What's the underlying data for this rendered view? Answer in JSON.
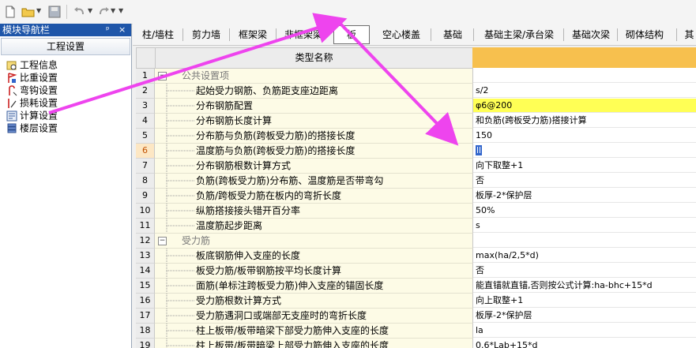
{
  "toolbar": {
    "buttons": [
      "new-file-icon",
      "open-folder-icon",
      "save-icon",
      "undo-icon",
      "redo-icon",
      "customize-icon"
    ]
  },
  "nav_panel": {
    "title": "模块导航栏",
    "pin_glyph": "ᵖ",
    "close_glyph": "×",
    "header": "工程设置",
    "items": [
      {
        "label": "工程信息",
        "icon": "project-info-icon"
      },
      {
        "label": "比重设置",
        "icon": "weight-ratio-icon"
      },
      {
        "label": "弯钩设置",
        "icon": "hook-setting-icon"
      },
      {
        "label": "损耗设置",
        "icon": "loss-setting-icon"
      },
      {
        "label": "计算设置",
        "icon": "calc-setting-icon"
      },
      {
        "label": "楼层设置",
        "icon": "floor-setting-icon"
      }
    ]
  },
  "tabs": [
    {
      "label": "柱/墙柱",
      "active": false
    },
    {
      "label": "剪力墙",
      "active": false
    },
    {
      "label": "框架梁",
      "active": false
    },
    {
      "label": "非框架梁",
      "active": false
    },
    {
      "label": "板",
      "active": true
    },
    {
      "label": "空心楼盖",
      "active": false
    },
    {
      "label": "基础",
      "active": false
    },
    {
      "label": "基础主梁/承台梁",
      "active": false
    },
    {
      "label": "基础次梁",
      "active": false
    },
    {
      "label": "砌体结构",
      "active": false
    },
    {
      "label": "其",
      "active": false
    }
  ],
  "grid": {
    "header": "类型名称",
    "rows": [
      {
        "num": "1",
        "type": "group",
        "name": "公共设置项",
        "value": ""
      },
      {
        "num": "2",
        "type": "item",
        "name": "起始受力钢筋、负筋距支座边距离",
        "value": "s/2"
      },
      {
        "num": "3",
        "type": "item",
        "name": "分布钢筋配置",
        "value": "φ6@200",
        "highlight": true
      },
      {
        "num": "4",
        "type": "item",
        "name": "分布钢筋长度计算",
        "value": "和负筋(跨板受力筋)搭接计算"
      },
      {
        "num": "5",
        "type": "item",
        "name": "分布筋与负筋(跨板受力筋)的搭接长度",
        "value": "150"
      },
      {
        "num": "6",
        "type": "item",
        "name": "温度筋与负筋(跨板受力筋)的搭接长度",
        "value": "ll",
        "selected": true,
        "editing": true
      },
      {
        "num": "7",
        "type": "item",
        "name": "分布钢筋根数计算方式",
        "value": "向下取整+1"
      },
      {
        "num": "8",
        "type": "item",
        "name": "负筋(跨板受力筋)分布筋、温度筋是否带弯勾",
        "value": "否"
      },
      {
        "num": "9",
        "type": "item",
        "name": "负筋/跨板受力筋在板内的弯折长度",
        "value": "板厚-2*保护层"
      },
      {
        "num": "10",
        "type": "item",
        "name": "纵筋搭接接头错开百分率",
        "value": "50%"
      },
      {
        "num": "11",
        "type": "item",
        "name": "温度筋起步距离",
        "value": "s"
      },
      {
        "num": "12",
        "type": "group",
        "name": "受力筋",
        "value": ""
      },
      {
        "num": "13",
        "type": "item",
        "name": "板底钢筋伸入支座的长度",
        "value": "max(ha/2,5*d)"
      },
      {
        "num": "14",
        "type": "item",
        "name": "板受力筋/板带钢筋按平均长度计算",
        "value": "否"
      },
      {
        "num": "15",
        "type": "item",
        "name": "面筋(单标注跨板受力筋)伸入支座的锚固长度",
        "value": "能直锚就直锚,否则按公式计算:ha-bhc+15*d"
      },
      {
        "num": "16",
        "type": "item",
        "name": "受力筋根数计算方式",
        "value": "向上取整+1"
      },
      {
        "num": "17",
        "type": "item",
        "name": "受力筋遇洞口或端部无支座时的弯折长度",
        "value": "板厚-2*保护层"
      },
      {
        "num": "18",
        "type": "item",
        "name": "柱上板带/板带暗梁下部受力筋伸入支座的长度",
        "value": "la"
      },
      {
        "num": "19",
        "type": "item",
        "name": "柱上板带/板带暗梁上部受力筋伸入支座的长度",
        "value": "0.6*Lab+15*d"
      }
    ]
  },
  "colors": {
    "title_bar": "#1f56a9",
    "header_value_col": "#f7c04e",
    "name_col_bg": "#fdfbe6",
    "highlight": "#ffff55",
    "annotation_arrow": "#ee44ee"
  }
}
